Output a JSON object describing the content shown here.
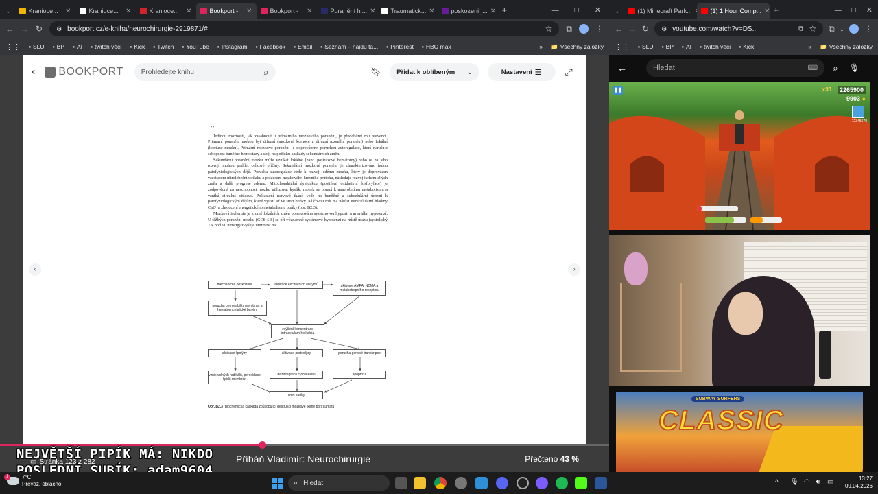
{
  "left_tabs": [
    {
      "title": "Kranioce...",
      "color": "#f2b600"
    },
    {
      "title": "Kranioce...",
      "color": "#ffffff"
    },
    {
      "title": "Kranioce...",
      "color": "#d2232a"
    },
    {
      "title": "Bookport -",
      "color": "#e0245e",
      "active": true
    },
    {
      "title": "Bookport -",
      "color": "#e0245e"
    },
    {
      "title": "Poranění hl...",
      "color": "#2a2a6a"
    },
    {
      "title": "Traumatick...",
      "color": "#ffffff"
    },
    {
      "title": "poskozeni_...",
      "color": "#6a1b9a"
    }
  ],
  "right_tabs": [
    {
      "title": "(1) Minecraft Park...",
      "color": "#ff0000"
    },
    {
      "title": "(1) 1 Hour Comp...",
      "color": "#ff0000",
      "active": true
    }
  ],
  "left_url": "bookport.cz/e-kniha/neurochirurgie-2919871/#",
  "right_url": "youtube.com/watch?v=DS...",
  "bookmarks": [
    "SLU",
    "BP",
    "AI",
    "twitch věci",
    "Kick",
    "Twitch",
    "YouTube",
    "Instagram",
    "Facebook",
    "Email",
    "Seznam – najdu ta...",
    "Pinterest",
    "HBO max"
  ],
  "all_bookmarks": "Všechny záložky",
  "right_bookmarks": [
    "SLU",
    "BP",
    "AI",
    "twitch věci",
    "Kick"
  ],
  "bookport": {
    "logo": "BOOKPORT",
    "search_placeholder": "Prohledejte knihu",
    "favorite": "Přidat k oblíbeným",
    "settings": "Nastavení",
    "book_title": "Příbáň Vladimír: Neurochirurgie",
    "read_label": "Přečteno",
    "read_pct": "43 %",
    "read_fraction": 0.43
  },
  "page": {
    "number": "122",
    "p1": "Jedinou možností, jak zasáhnout u primárního mozkového poranění, je předcházet mu prevencí. Primární poranění mohou být difuzní (mozková komoce a difuzní axonální poranění) nebo fokální (kontuze mozku). Primární mozkové poranění je doprovázeno poruchou autoregulace, která narušuje schopnost buněčné hemostázy a stojí na počátku kaskády sekundárních změn.",
    "p2": "Sekundární poranění mozku může vznikat lokálně (např. posírazové hematomy) nebo se na jeho rozvoji mohou podílet celkové příčiny. Sekundární mozkové poranění je charakterizováno řadou patofyziologických dějů. Porucha autoregulace vede k rozvoji edému mozku, který je doprovázen vzestupem nitrolebečního tlaku a poklesem mozkového krevního průtoku, následuje rozvoj ischemických změn a další progrese edému. Mitochondriální dysfunkce (postižení oxidativní fosforylace) je zodpovědná za neschopnost mozku utilizovat kyslík, mozek se obrací k anaerobnímu metabolismu a vzniká circulus vitiosus. Poškození nervové tkáně vede na buněčné a subcelulární úrovni k patofyziologickým dějům, které vyústí až ve smrt buňky. Klíčovou roli má nárůst intracelulární hladiny Ca2+ a zhroucení energetického metabolismu buňky (obr. B2.3).",
    "p3": "Mozková ischemie je kromě lokálních změn potencována systémovou hypoxií a arteriální hypotenzí. U těžkých poranění mozku (GCS ≤ 8) se při významné systémové hypotenzi na místě úrazu (systolický TK pod 90 mmHg) zvyšuje úmrtnost na",
    "diagram": {
      "b1": "mechanické poškození",
      "b2": "aktivace excitačních enzymů",
      "b3": "aktivace AMPA, NDMA a metabotropního receptoru",
      "b4": "porucha permeability membrán a hematoencefalické bariéry",
      "b5": "zvýšení koncentrace intracelulárního kalcia",
      "b6": "aktivace lipolýzy",
      "b7": "aktivace proteolýzy",
      "b8": "porucha genové transkripce",
      "b9": "vznik volných radikálů, peroxidace lipidů membrán",
      "b10": "dezintegrace cytoskeletu",
      "b11": "apoptóza",
      "b12": "smrt buňky"
    },
    "caption_label": "Obr. B2.3",
    "caption": "Biochemická kaskáda způsobující destrukci mozkové tkáně po traumatu"
  },
  "overlay": {
    "line1": "NEJVĚTŠÍ PIPÍK MÁ: NIKDO",
    "line2": "POSLEDNÍ SUBÍK: adam9604",
    "page_info": "Stránka 123 z 282"
  },
  "youtube": {
    "search_placeholder": "Hledat",
    "multiplier": "x30",
    "score": "2265900",
    "coins": "9903",
    "player_id": "12345678",
    "banner": "CLASSIC",
    "banner_top": "SUBWAY SURFERS"
  },
  "taskbar": {
    "temp": "7°C",
    "weather": "Převáž. oblačno",
    "search": "Hledat",
    "time": "13:27",
    "date": "09.04.2026",
    "badge": "1"
  },
  "colors": {
    "accent": "#e0245e",
    "bookport_bg": "#ececec"
  }
}
